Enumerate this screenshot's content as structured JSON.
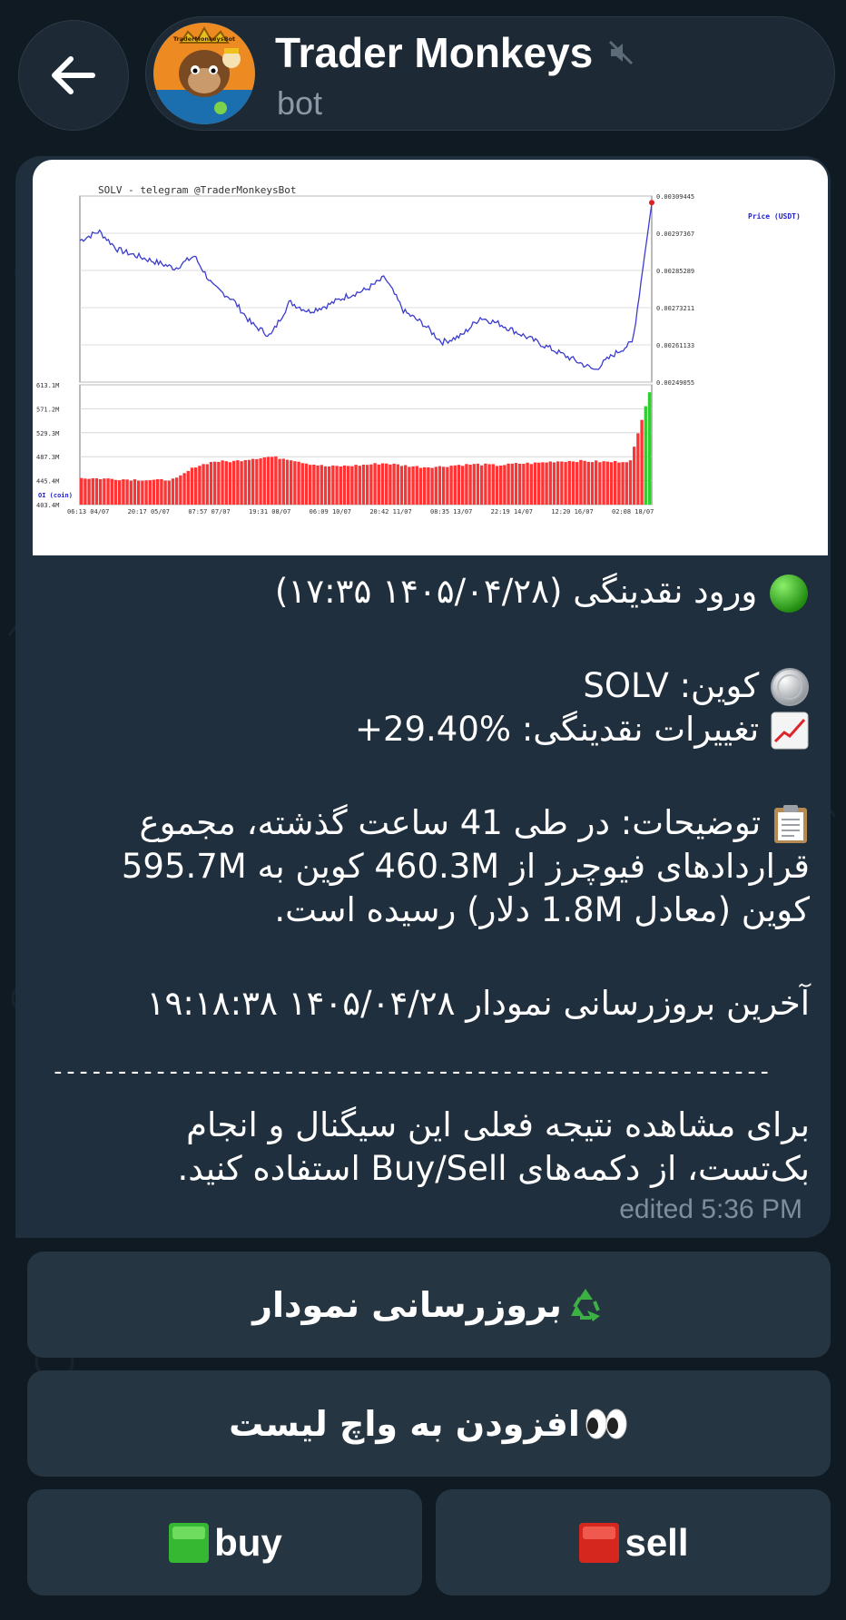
{
  "header": {
    "title": "Trader Monkeys",
    "subtitle": "bot",
    "avatar_text": "TraderMonkeysBot"
  },
  "chart_data": {
    "type": "line",
    "title": "SOLV - telegram @TraderMonkeysBot",
    "series": [
      {
        "name": "Price (USDT)",
        "values": [
          0.00295,
          0.00298,
          0.00292,
          0.0029,
          0.00288,
          0.00286,
          0.0029,
          0.0028,
          0.00276,
          0.00268,
          0.00264,
          0.00275,
          0.00272,
          0.00274,
          0.00277,
          0.00279,
          0.00283,
          0.00272,
          0.00268,
          0.00262,
          0.00264,
          0.0027,
          0.00268,
          0.00265,
          0.00262,
          0.00259,
          0.00256,
          0.00253,
          0.00258,
          0.00262,
          0.00307
        ]
      },
      {
        "name": "OI (coin)",
        "values": [
          450,
          449,
          448,
          447,
          446,
          448,
          470,
          479,
          479,
          484,
          487,
          483,
          475,
          470,
          471,
          473,
          476,
          472,
          469,
          470,
          473,
          474,
          472,
          475,
          476,
          479,
          480,
          479,
          478,
          480,
          600
        ]
      }
    ],
    "price_axis_ticks": [
      "0.00309445",
      "0.00297367",
      "0.00285289",
      "0.00273211",
      "0.00261133",
      "0.00249055"
    ],
    "oi_axis_ticks": [
      "613.1M",
      "571.2M",
      "529.3M",
      "487.3M",
      "445.4M",
      "403.4M"
    ],
    "x_ticks": [
      "06:13 04/07",
      "20:17 05/07",
      "07:57 07/07",
      "19:31 08/07",
      "06:09 10/07",
      "20:42 11/07",
      "08:35 13/07",
      "22:19 14/07",
      "12:20 16/07",
      "02:08 18/07"
    ],
    "price_label": "Price (USDT)",
    "oi_label": "OI (coin)",
    "colors": {
      "price": "#3b3bcf",
      "oi": "#ff3333",
      "oi_last": "#33cc33"
    }
  },
  "message": {
    "line1_text": "ورود نقدینگی (۱۴۰۵/۰۴/۲۸ ۱۷:۳۵)",
    "coin_label": "کوین: SOLV",
    "change_label": "تغییرات نقدینگی: %29.40+",
    "desc_line1": "توضیحات: در طی 41 ساعت گذشته، مجموع",
    "desc_line2": "قراردادهای فیوچرز از 460.3M کوین به 595.7M",
    "desc_line3": "کوین (معادل 1.8M دلار) رسیده است.",
    "update_line": "آخرین بروزرسانی نمودار ۱۴۰۵/۰۴/۲۸ ۱۹:۱۸:۳۸",
    "divider": "--------------------------------------------------------",
    "footer_line1": "برای مشاهده نتیجه فعلی این سیگنال و انجام",
    "footer_line2": "بک‌تست، از دکمه‌های Buy/Sell استفاده کنید.",
    "edited": "edited 5:36 PM"
  },
  "keyboard": {
    "refresh_label": "بروزرسانی نمودار",
    "watchlist_label": "افزودن به واچ لیست",
    "buy_label": "buy",
    "sell_label": "sell"
  },
  "icons": {
    "back": "arrow-left-icon",
    "mute": "mute-icon",
    "status": "green-circle-icon",
    "coin": "coin-icon",
    "chart": "chart-increasing-icon",
    "clipboard": "clipboard-icon",
    "recycle": "recycle-icon",
    "eyes": "eyes-icon",
    "green_square": "green-square-icon",
    "red_square": "red-square-icon"
  }
}
